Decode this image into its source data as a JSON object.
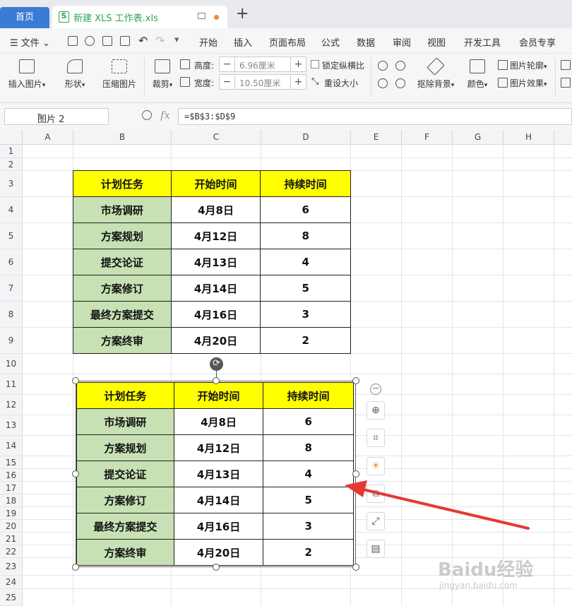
{
  "tabs": {
    "home": "首页",
    "file_title": "新建 XLS 工作表.xls",
    "new_tab": "+"
  },
  "menu": {
    "file": "文件",
    "items": [
      "开始",
      "插入",
      "页面布局",
      "公式",
      "数据",
      "审阅",
      "视图",
      "开发工具",
      "会员专享"
    ]
  },
  "ribbon": {
    "insert_picture": "插入图片",
    "shape": "形状",
    "compress_picture": "压缩图片",
    "crop": "裁剪",
    "height_label": "高度:",
    "height_value": "6.96厘米",
    "width_label": "宽度:",
    "width_value": "10.50厘米",
    "lock_ratio": "锁定纵横比",
    "reset_size": "重设大小",
    "remove_bg": "抠除背景",
    "color": "颜色",
    "picture_outline": "图片轮廓",
    "picture_effect": "图片效果"
  },
  "formula_bar": {
    "name_box": "图片 2",
    "fx": "fx",
    "formula": "=$B$3:$D$9"
  },
  "columns": [
    "A",
    "B",
    "C",
    "D",
    "E",
    "F",
    "G",
    "H"
  ],
  "rows": [
    "1",
    "2",
    "3",
    "4",
    "5",
    "6",
    "7",
    "8",
    "9",
    "10",
    "11",
    "12",
    "13",
    "14",
    "15",
    "16",
    "17",
    "18",
    "19",
    "20",
    "21",
    "22",
    "23",
    "24",
    "25"
  ],
  "table": {
    "headers": [
      "计划任务",
      "开始时间",
      "持续时间"
    ],
    "rows": [
      [
        "市场调研",
        "4月8日",
        "6"
      ],
      [
        "方案规划",
        "4月12日",
        "8"
      ],
      [
        "提交论证",
        "4月13日",
        "4"
      ],
      [
        "方案修订",
        "4月14日",
        "5"
      ],
      [
        "最终方案提交",
        "4月16日",
        "3"
      ],
      [
        "方案终审",
        "4月20日",
        "2"
      ]
    ]
  },
  "picture": {
    "headers": [
      "计划任务",
      "开始时间",
      "持续时间"
    ],
    "rows": [
      [
        "市场调研",
        "4月8日",
        "6"
      ],
      [
        "方案规划",
        "4月12日",
        "8"
      ],
      [
        "提交论证",
        "4月13日",
        "4"
      ],
      [
        "方案修订",
        "4月14日",
        "5"
      ],
      [
        "最终方案提交",
        "4月16日",
        "3"
      ],
      [
        "方案终审",
        "4月20日",
        "2"
      ]
    ]
  },
  "colors": {
    "header_fill": "#ffff00",
    "task_fill": "#c7e0b4",
    "arrow": "#e53935",
    "tab_active": "#3a7bd5"
  },
  "watermark": {
    "main": "Baidu经验",
    "sub": "jingyan.baidu.com"
  }
}
